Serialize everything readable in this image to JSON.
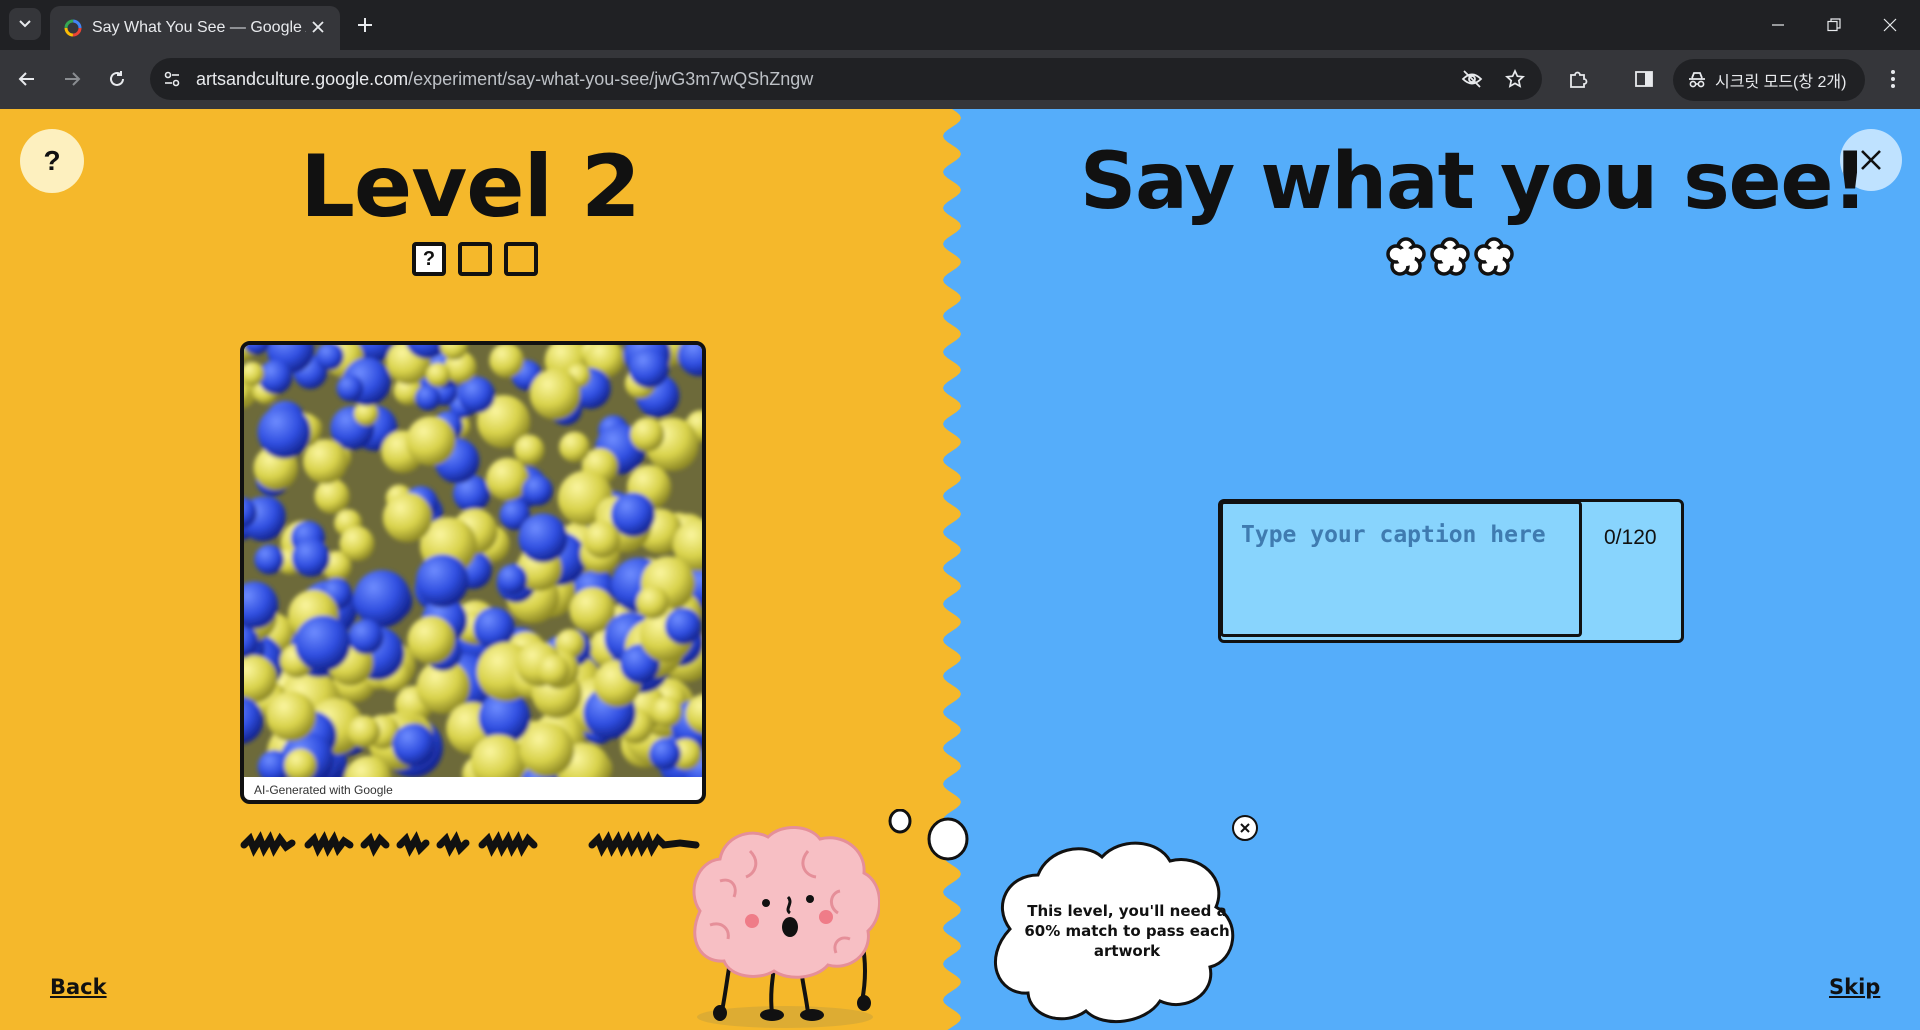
{
  "browser": {
    "tab_title": "Say What You See — Google Arts & Culture",
    "url_domain": "artsandculture.google.com",
    "url_path": "/experiment/say-what-you-see/jwG3m7wQShZngw",
    "incognito_label": "시크릿 모드(창 2개)"
  },
  "game": {
    "level_title": "Level 2",
    "progress_current": "?",
    "title": "Say what you see!",
    "artwork_caption": "AI-Generated with Google",
    "help_label": "?",
    "back_label": "Back",
    "skip_label": "Skip",
    "hint_text": "This level, you'll need a 60% match to pass each artwork",
    "input_placeholder": "Type your caption here",
    "char_count": "0/120"
  },
  "colors": {
    "left_bg": "#f5b82b",
    "right_bg": "#55adfa",
    "input_bg": "#88d4fd"
  }
}
